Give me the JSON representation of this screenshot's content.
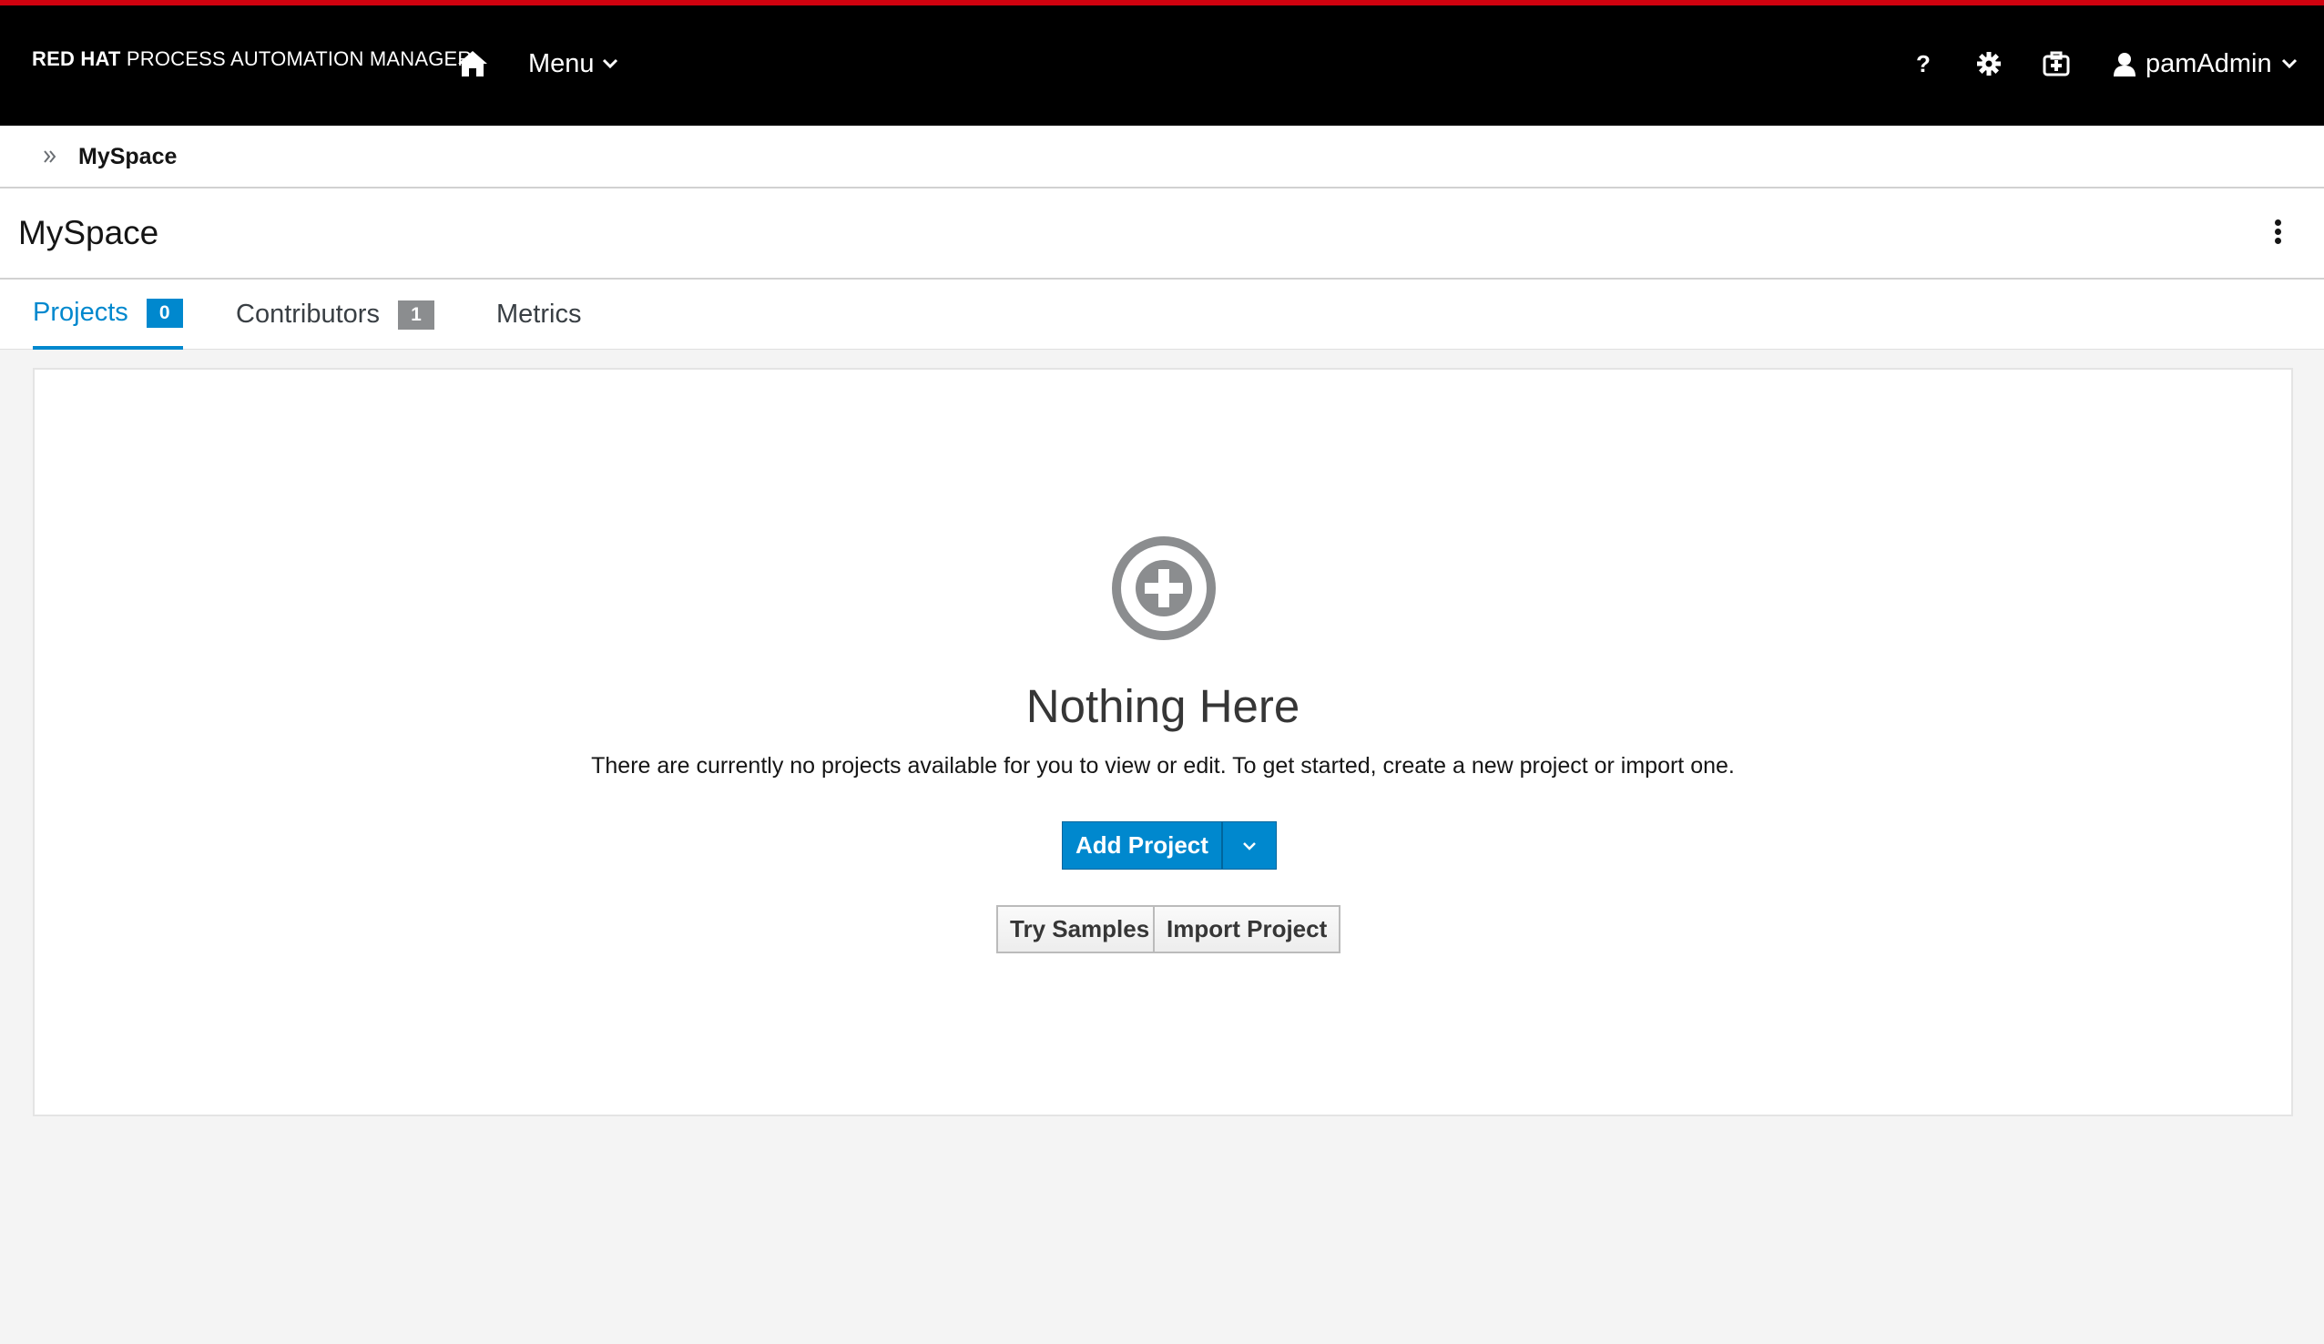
{
  "app": {
    "brand_bold": "RED HAT",
    "brand_rest": " PROCESS AUTOMATION MANAGER"
  },
  "nav": {
    "menu_label": "Menu",
    "help_label": "?",
    "user_label": "pamAdmin",
    "icons": [
      "home-icon",
      "help-icon",
      "gear-icon",
      "case-icon",
      "user-icon",
      "chevron-down-icon"
    ]
  },
  "breadcrumb": {
    "current": "MySpace"
  },
  "page": {
    "title": "MySpace"
  },
  "tabs": [
    {
      "label": "Projects",
      "count": "0",
      "active": true
    },
    {
      "label": "Contributors",
      "count": "1",
      "active": false
    },
    {
      "label": "Metrics",
      "active": false
    }
  ],
  "empty_state": {
    "title": "Nothing Here",
    "description": "There are currently no projects available for you to view or edit. To get started, create a new project or import one.",
    "add_project_label": "Add Project",
    "try_samples_label": "Try Samples",
    "import_project_label": "Import Project"
  },
  "colors": {
    "accent": "#0088ce",
    "topbar": "#000000",
    "topbar_stripe": "#d0020f",
    "badge_grey": "#8b8d8f"
  }
}
